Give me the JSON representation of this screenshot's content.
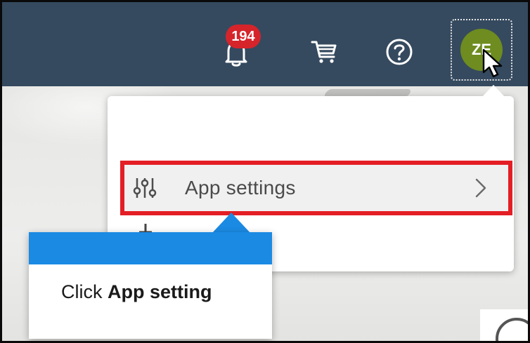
{
  "header": {
    "notifications_badge": "194",
    "icons": {
      "notifications": "bell-icon",
      "cart": "cart-icon",
      "help": "help-circle-icon"
    },
    "avatar_initials": "ZE"
  },
  "menu": {
    "app_settings_label": "App settings",
    "app_settings_icon": "sliders-icon",
    "chevron_icon": "chevron-right-icon"
  },
  "callout": {
    "text_prefix": "Click ",
    "text_bold": "App setting"
  },
  "colors": {
    "header_bg": "#354a5f",
    "badge_bg": "#d6242b",
    "avatar_bg": "#6e8c1f",
    "highlight_border": "#e31e24",
    "callout_accent": "#1b8ae3"
  }
}
